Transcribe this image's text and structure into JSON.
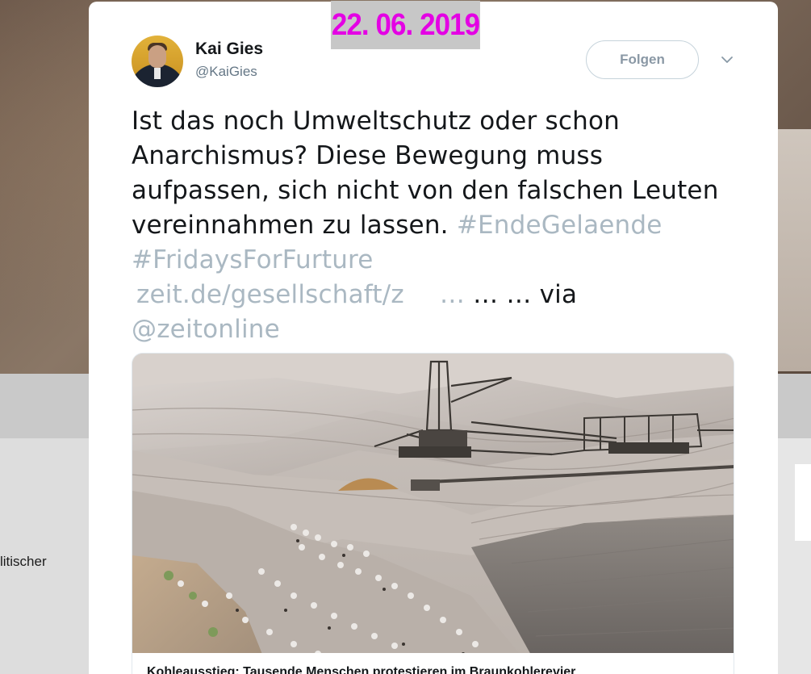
{
  "background": {
    "sidebar_text": "litischer"
  },
  "stamp": {
    "date": "22. 06. 2019"
  },
  "tweet": {
    "author_name": "Kai Gies",
    "author_handle": "@KaiGies",
    "follow_label": "Folgen",
    "text_lines": [
      "Ist das noch Umweltschutz oder schon",
      "Anarchismus? Diese Bewegung muss",
      "aufpassen, sich nicht von den falschen Leuten",
      "vereinnahmen zu lassen."
    ],
    "hashtag_1": "#EndeGelaende",
    "hashtag_2": "#FridaysForFurture",
    "link": "zeit.de/gesellschaft/z",
    "link_ellipsis": "…",
    "link_suffix": " … … via",
    "mention": "@zeitonline"
  },
  "card": {
    "image_alt": "Braunkohletagebau mit Schaufelradbagger und Demonstrierenden",
    "caption": "Kohleausstieg: Tausende Menschen protestieren im Braunkohlerevier"
  },
  "icons": {
    "more": "chevron-down-icon"
  },
  "colors": {
    "stamp_text": "#e400e4",
    "stamp_bg": "#c7c7c7",
    "link": "#aab8c2",
    "text": "#14171a",
    "secondary": "#657786"
  }
}
